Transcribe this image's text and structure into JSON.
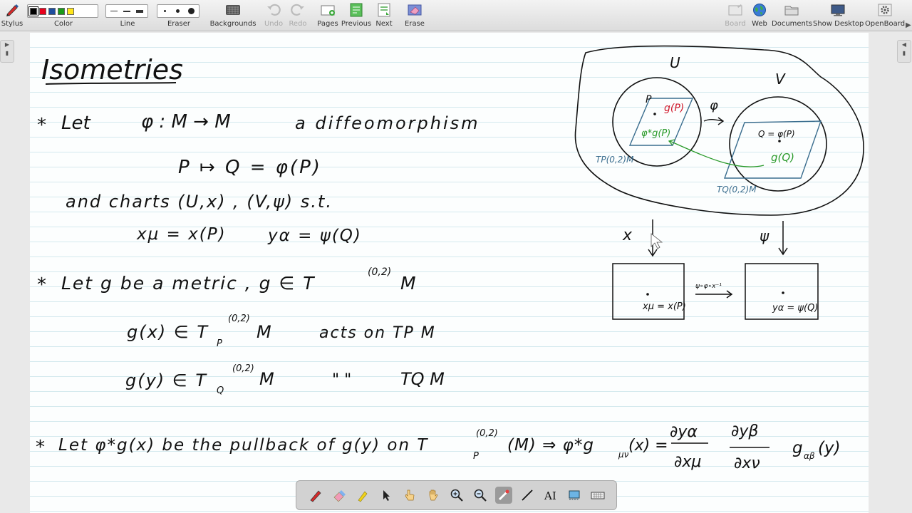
{
  "toolbar": {
    "stylus": "Stylus",
    "color": "Color",
    "line": "Line",
    "eraser": "Eraser",
    "backgrounds": "Backgrounds",
    "undo": "Undo",
    "redo": "Redo",
    "pages": "Pages",
    "previous": "Previous",
    "next": "Next",
    "erase": "Erase",
    "board": "Board",
    "web": "Web",
    "documents": "Documents",
    "show_desktop": "Show Desktop",
    "openboard": "OpenBoard",
    "colors": [
      "#000000",
      "#e8001c",
      "#1f4e9e",
      "#1a9a1a",
      "#ffe51a"
    ]
  },
  "notes": {
    "title": "Isometries",
    "l1_star": "*",
    "l1_let": "Let",
    "l1_map": "φ : M → M",
    "l1_diffeo": "a diffeomorphism",
    "l2": "P ↦ Q = φ(P)",
    "l3": "and charts (U,x) , (V,ψ) s.t.",
    "l4a": "xμ = x(P)",
    "l4b": "yα = ψ(Q)",
    "l5_star": "*",
    "l5": "Let g be a metric , g ∈ T",
    "l5_sup": "(0,2)",
    "l5_m": "M",
    "l6a": "g(x) ∈ T",
    "l6a_sup": "(0,2)",
    "l6a_sub": "P",
    "l6a_m": "M",
    "l6b": "acts on TP M",
    "l7a": "g(y) ∈ T",
    "l7a_sup": "(0,2)",
    "l7a_sub": "Q",
    "l7a_m": "M",
    "l7b": "\"   \"",
    "l7c": "TQ M",
    "l8_star": "*",
    "l8a": "Let φ*g(x) be the pullback of g(y) on T",
    "l8_sup": "(0,2)",
    "l8_sub": "P",
    "l8b": "(M) ⇒ φ*g",
    "l8_sub2": "μν",
    "l8c": "(x) =",
    "frac1_num": "∂yα",
    "frac1_den": "∂xμ",
    "frac2_num": "∂yβ",
    "frac2_den": "∂xν",
    "l8d": "g",
    "l8_sub3": "αβ",
    "l8e": "(y)"
  },
  "diagram": {
    "U": "U",
    "V": "V",
    "phi": "φ",
    "P": "P",
    "gP": "g(P)",
    "pullback": "φ*g(P)",
    "TP": "TP(0,2)M",
    "Q": "Q = φ(P)",
    "gQ": "g(Q)",
    "TQ": "TQ(0,2)M",
    "chi": "x",
    "psi": "ψ",
    "transition": "ψ∘φ∘x⁻¹",
    "box1": "xμ = x(P)",
    "box2": "yα = ψ(Q)",
    "red": "#d0182a",
    "green": "#2a9a2a",
    "blue": "#3a6d8e"
  }
}
